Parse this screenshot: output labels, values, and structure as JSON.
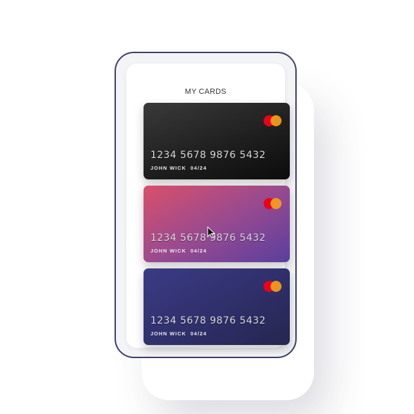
{
  "header": {
    "title": "MY CARDS"
  },
  "cards": [
    {
      "number": "1234 5678 9876 5432",
      "holder": "JOHN WICK",
      "expiry": "04/24",
      "logo_icon": "mastercard-icon",
      "gradient": [
        "#3a3a3a",
        "#0c0c0c"
      ]
    },
    {
      "number": "1234 5678 9876 5432",
      "holder": "JOHN WICK",
      "expiry": "04/24",
      "logo_icon": "mastercard-icon",
      "gradient": [
        "#d9506b",
        "#5a3f9e"
      ]
    },
    {
      "number": "1234 5678 9876 5432",
      "holder": "JOHN WICK",
      "expiry": "04/24",
      "logo_icon": "mastercard-icon",
      "gradient": [
        "#3b3b86",
        "#262650"
      ]
    }
  ],
  "colors": {
    "phone_frame": "#3c3f6b",
    "logo_red": "#eb001b",
    "logo_orange": "#f79e1b"
  }
}
